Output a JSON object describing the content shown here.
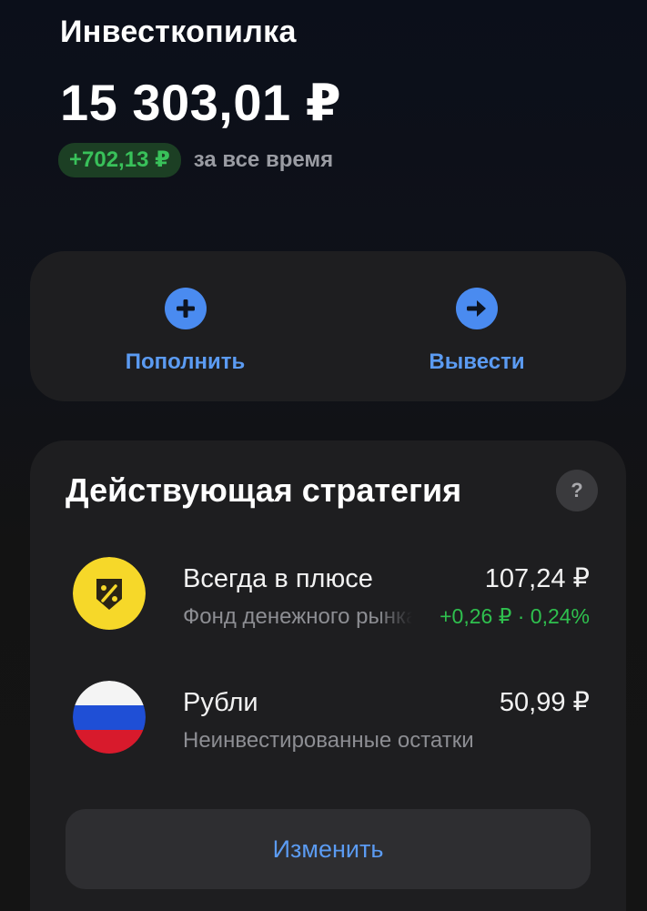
{
  "header": {
    "title": "Инвесткопилка",
    "balance": "15 303,01 ₽",
    "delta": "+702,13 ₽",
    "delta_caption": "за все время"
  },
  "actions": {
    "deposit_label": "Пополнить",
    "withdraw_label": "Вывести"
  },
  "strategy": {
    "title": "Действующая стратегия",
    "help_label": "?",
    "assets": [
      {
        "name": "Всегда в плюсе",
        "subtitle": "Фонд денежного рынка",
        "value": "107,24 ₽",
        "change": "+0,26 ₽ · 0,24%",
        "icon": "shield-percent-icon"
      },
      {
        "name": "Рубли",
        "subtitle": "Неинвестированные остатки",
        "value": "50,99 ₽",
        "change": "",
        "icon": "russia-flag-icon"
      }
    ],
    "change_button_label": "Изменить"
  },
  "colors": {
    "accent": "#4a8bf0",
    "positive": "#2fc04e",
    "card_bg": "#1e1e20",
    "yellow": "#f6d829"
  }
}
